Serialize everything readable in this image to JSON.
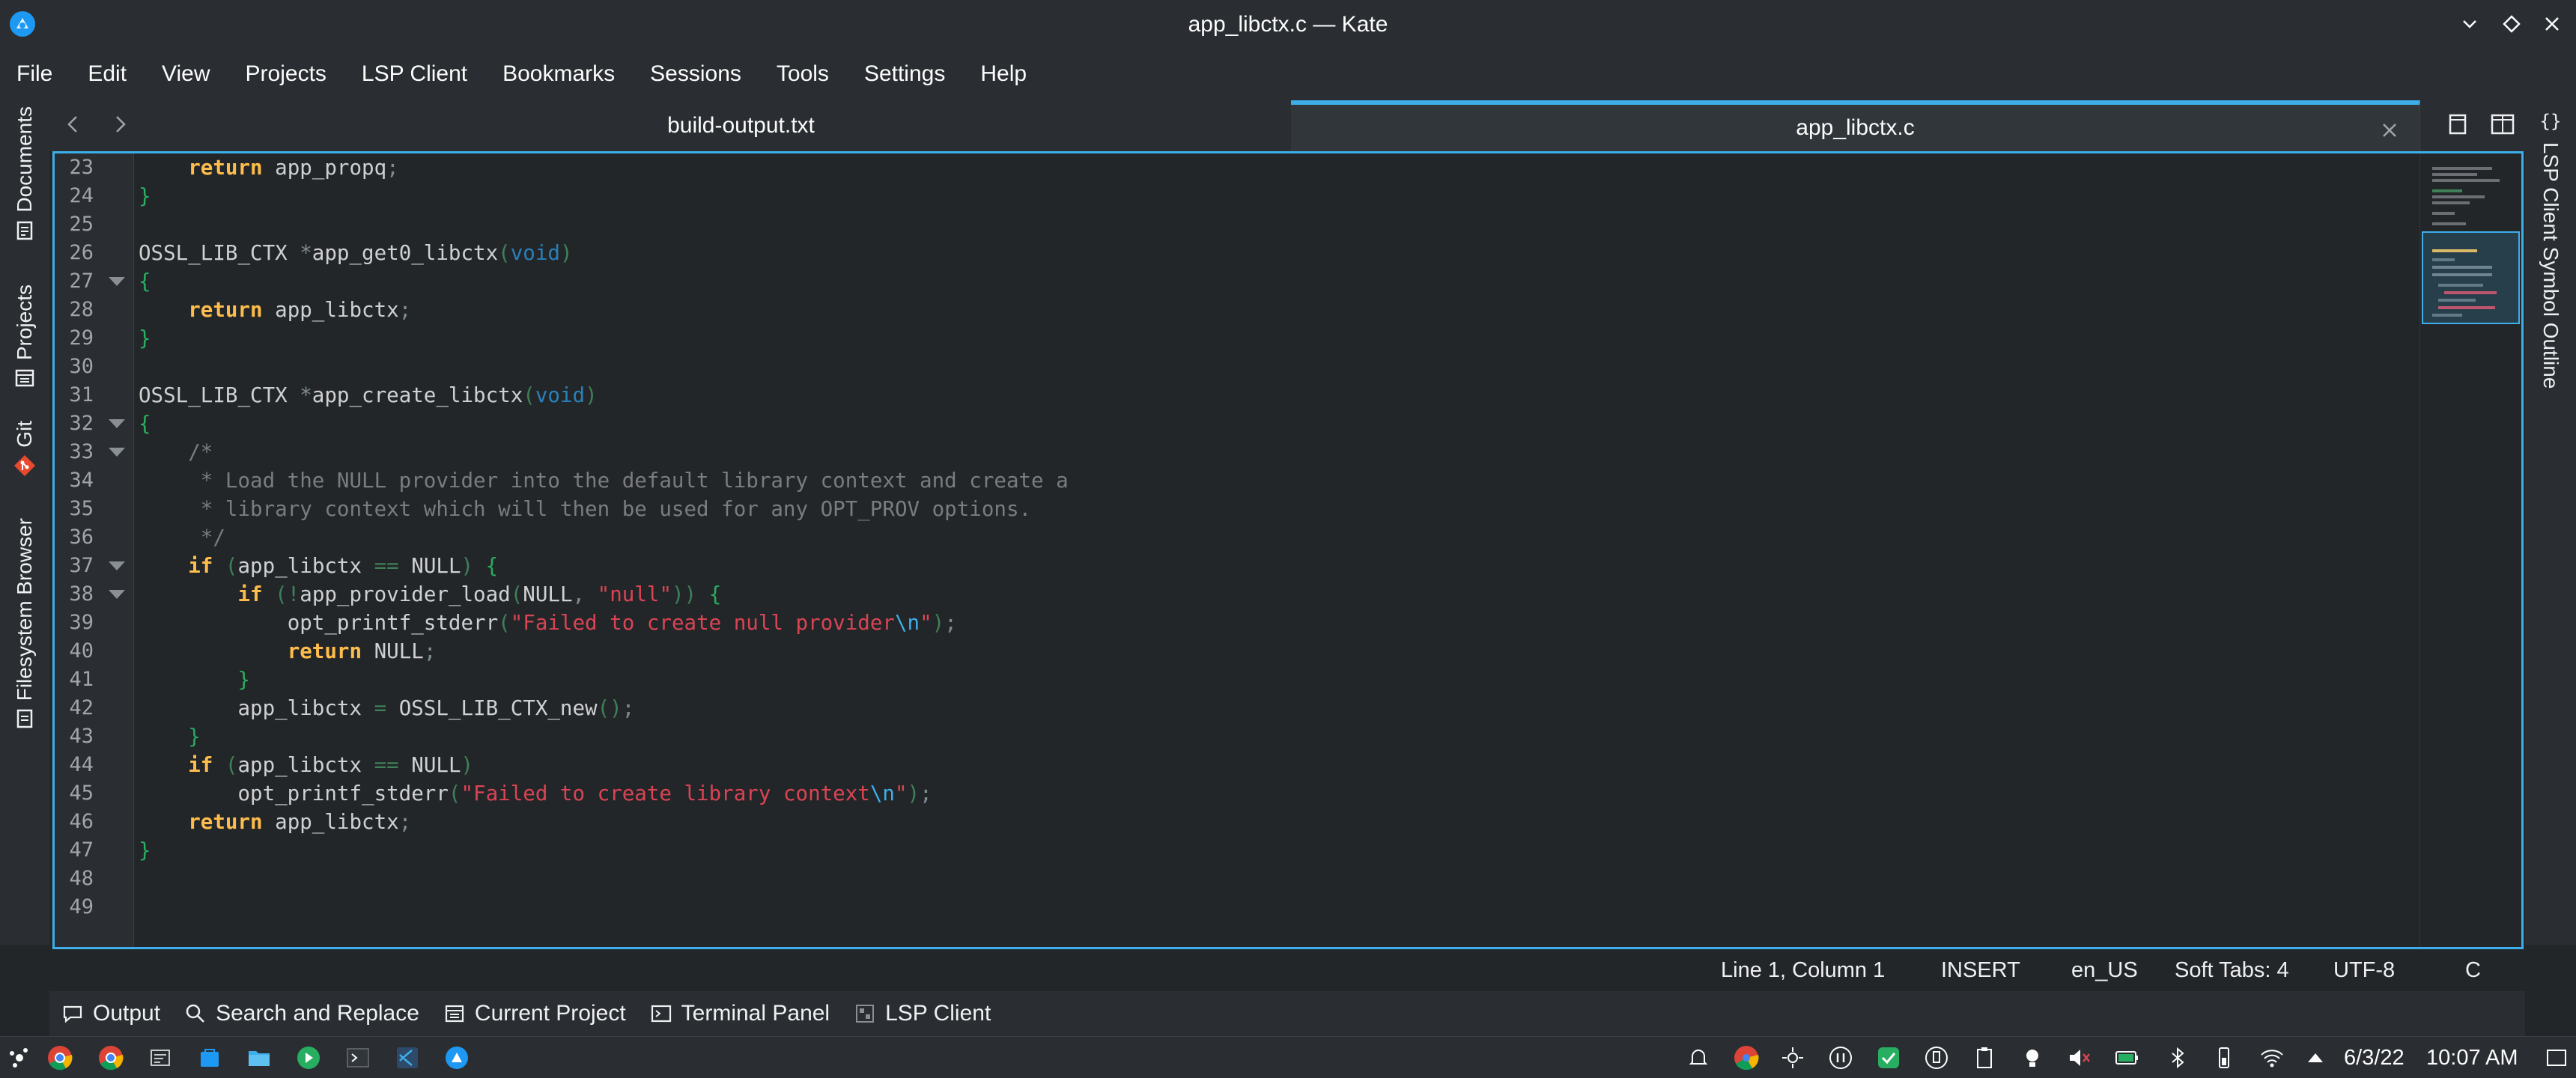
{
  "window": {
    "title": "app_libctx.c — Kate"
  },
  "menu": [
    "File",
    "Edit",
    "View",
    "Projects",
    "LSP Client",
    "Bookmarks",
    "Sessions",
    "Tools",
    "Settings",
    "Help"
  ],
  "left_panels": [
    "Documents",
    "Projects",
    "Git",
    "Filesystem Browser"
  ],
  "right_panels": [
    "LSP Client Symbol Outline"
  ],
  "tabs": [
    {
      "label": "build-output.txt",
      "active": false
    },
    {
      "label": "app_libctx.c",
      "active": true
    }
  ],
  "line_numbers": [
    "23",
    "24",
    "25",
    "26",
    "27",
    "28",
    "29",
    "30",
    "31",
    "32",
    "33",
    "34",
    "35",
    "36",
    "37",
    "38",
    "39",
    "40",
    "41",
    "42",
    "43",
    "44",
    "45",
    "46",
    "47",
    "48",
    "49"
  ],
  "code": {
    "l23_ret": "return",
    "l23_rest": " app_propq",
    "l24": "}",
    "l26_a": "OSSL_LIB_CTX ",
    "l26_b": "*",
    "l26_c": "app_get0_libctx",
    "l26_void": "void",
    "l27": "{",
    "l28_ret": "return",
    "l28_rest": " app_libctx",
    "l29": "}",
    "l31_a": "OSSL_LIB_CTX ",
    "l31_b": "*",
    "l31_c": "app_create_libctx",
    "l31_void": "void",
    "l32": "{",
    "l33": "    /*",
    "l34": "     * Load the NULL provider into the default library context and create a",
    "l35": "     * library context which will then be used for any OPT_PROV options.",
    "l36": "     */",
    "l37_if": "if",
    "l37_rest": "app_libctx ",
    "l37_eq": "==",
    "l37_null": " NULL",
    "l38_if": "if",
    "l38_not": "!",
    "l38_fn": "app_provider_load",
    "l38_null": "NULL",
    "l38_str": "\"null\"",
    "l39_fn": "opt_printf_stderr",
    "l39_str": "\"Failed to create null provider",
    "l39_esc": "\\n",
    "l39_q": "\"",
    "l40_ret": "return",
    "l40_null": " NULL",
    "l41": "}",
    "l42_a": "app_libctx ",
    "l42_eq": "=",
    "l42_fn": " OSSL_LIB_CTX_new",
    "l43": "}",
    "l44_if": "if",
    "l44_rest": "app_libctx ",
    "l44_eq": "==",
    "l44_null": " NULL",
    "l45_fn": "opt_printf_stderr",
    "l45_str": "\"Failed to create library context",
    "l45_esc": "\\n",
    "l45_q": "\"",
    "l46_ret": "return",
    "l46_rest": " app_libctx",
    "l47": "}"
  },
  "status": {
    "position": "Line 1, Column 1",
    "mode": "INSERT",
    "dictionary": "en_US",
    "indent": "Soft Tabs: 4",
    "encoding": "UTF-8",
    "language": "C"
  },
  "bottom_tools": [
    "Output",
    "Search and Replace",
    "Current Project",
    "Terminal Panel",
    "LSP Client"
  ],
  "taskbar": {
    "date": "6/3/22",
    "time": "10:07 AM"
  },
  "colors": {
    "accent": "#3daee9",
    "keyword": "#fdbc4b",
    "type": "#2980b9",
    "string": "#da4453",
    "comment": "#7a7c7d",
    "bracket": "#27ae60"
  }
}
